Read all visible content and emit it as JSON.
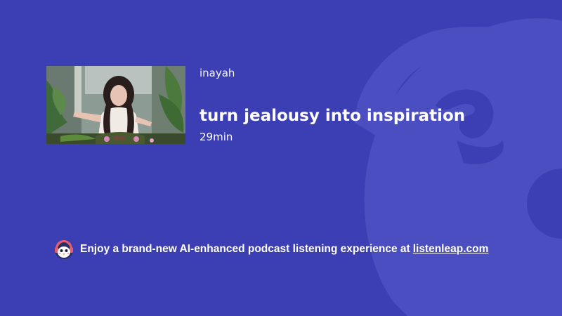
{
  "episode": {
    "channel": "inayah",
    "title": "turn jealousy into inspiration",
    "duration": "29min"
  },
  "promo": {
    "text": "Enjoy a brand-new AI-enhanced podcast listening experience at",
    "link_text": "listenleap.com"
  },
  "icons": {
    "promo": "penguin-mascot-icon",
    "background": "penguin-mascot-watermark"
  },
  "colors": {
    "background": "#3c3fb4",
    "text": "#ffffff",
    "watermark": "#4a4ec0"
  }
}
